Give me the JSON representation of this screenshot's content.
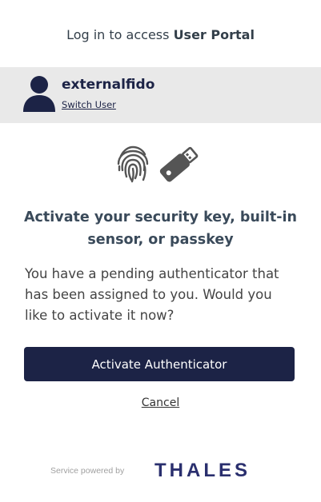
{
  "header": {
    "prefix": "Log in to access",
    "portal_name": "User Portal"
  },
  "user": {
    "username": "externalfido",
    "switch_label": "Switch User"
  },
  "icons": {
    "left": "fingerprint-icon",
    "right": "usb-security-key-icon"
  },
  "main": {
    "title": "Activate your security key, built-in sensor, or passkey",
    "description": "You have a pending authenticator that has been assigned to you. Would you like to activate it now?",
    "activate_button": "Activate Authenticator",
    "cancel_link": "Cancel"
  },
  "footer": {
    "powered_text": "Service powered by",
    "brand": "THALES"
  },
  "colors": {
    "primary": "#1c2346",
    "band": "#e9e9e9",
    "icon": "#555555",
    "brand": "#2a2f6e",
    "brand_accent": "#00b6d6"
  }
}
